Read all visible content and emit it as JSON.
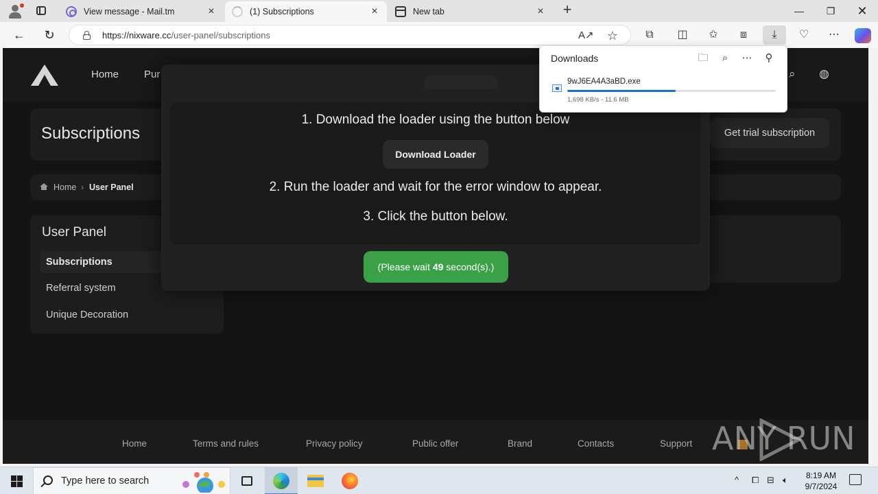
{
  "browser": {
    "tabs": [
      {
        "title": "View message - Mail.tm",
        "icon": "mail-at-icon",
        "active": false
      },
      {
        "title": "(1) Subscriptions",
        "icon": "loading-spinner-icon",
        "active": true
      },
      {
        "title": "New tab",
        "icon": "new-tab-icon",
        "active": false
      }
    ],
    "url": "https://nixware.cc/user-panel/subscriptions",
    "url_host": "https://nixware.cc",
    "url_path": "/user-panel/subscriptions"
  },
  "downloads": {
    "title": "Downloads",
    "file_name": "9wJ6EA4A3aBD.exe",
    "meta": "1,698 KB/s - 11.6 MB",
    "progress": 0.52
  },
  "site": {
    "nav": [
      "Home",
      "Pur"
    ],
    "page_title": "Subscriptions",
    "trial_button": "Get trial subscription",
    "breadcrumb": {
      "home": "Home",
      "separator": "›",
      "current": "User Panel"
    },
    "sidebar": {
      "title": "User Panel",
      "items": [
        "Subscriptions",
        "Referral system",
        "Unique Decoration"
      ]
    },
    "footer": [
      "Home",
      "Terms and rules",
      "Privacy policy",
      "Public offer",
      "Brand",
      "Contacts",
      "Support"
    ]
  },
  "modal": {
    "step1": "1. Download the loader using the button below",
    "download_button": "Download Loader",
    "step2": "2. Run the loader and wait for the error window to appear.",
    "step3": "3. Click the button below.",
    "wait_prefix": "(Please wait ",
    "wait_seconds": "49",
    "wait_suffix": " second(s).)"
  },
  "watermark": "ANY RUN",
  "taskbar": {
    "search_placeholder": "Type here to search",
    "time": "8:19 AM",
    "date": "9/7/2024"
  },
  "colors": {
    "accent_green": "#3aa149",
    "download_progress": "#1a6fd0",
    "page_background": "#141414"
  }
}
